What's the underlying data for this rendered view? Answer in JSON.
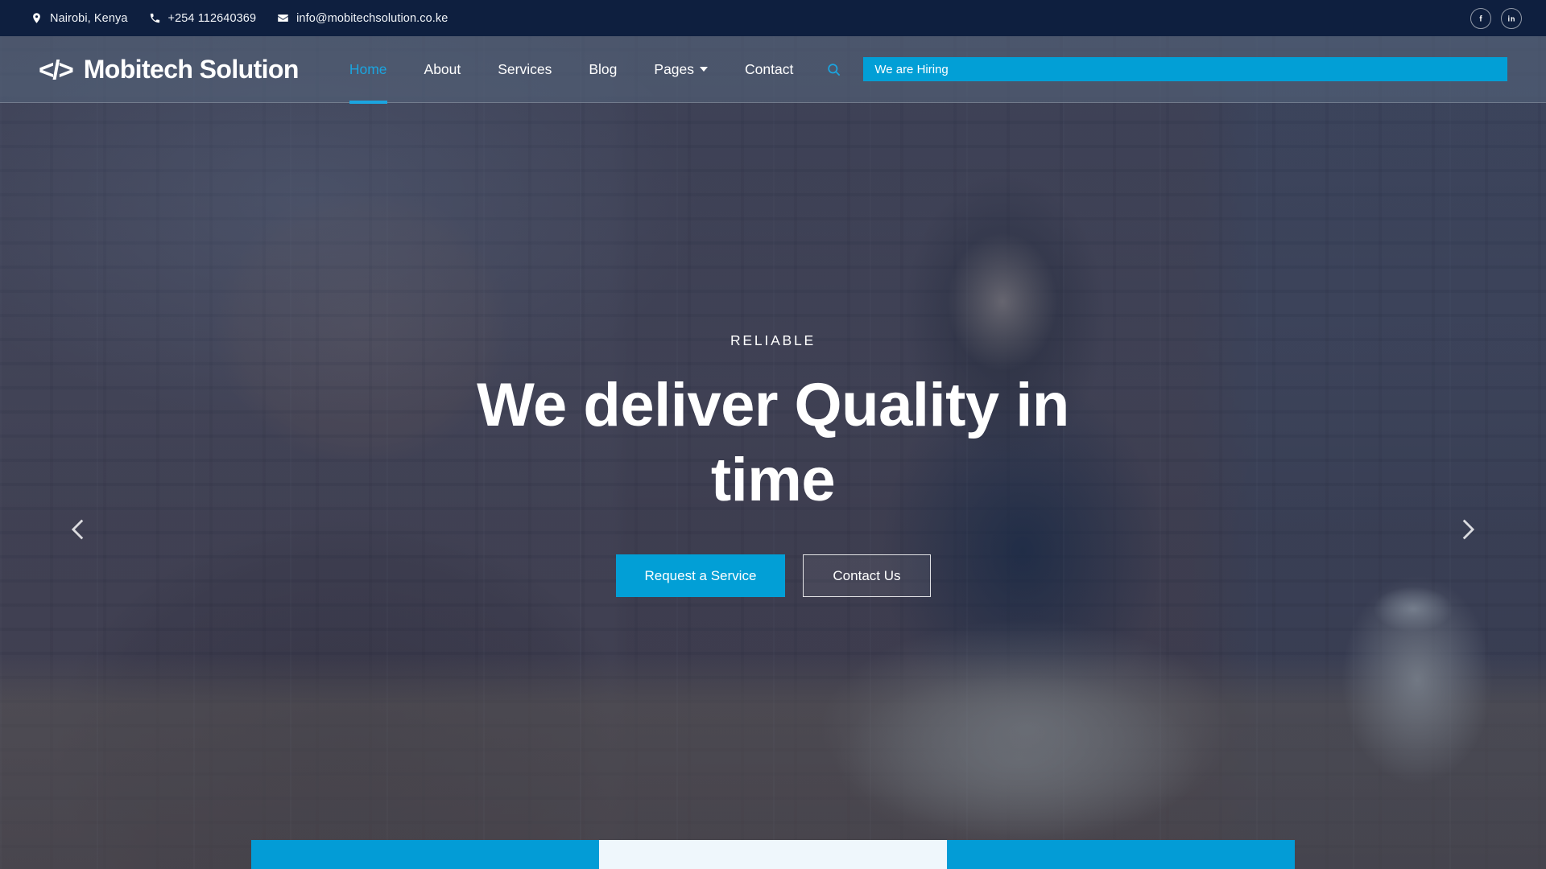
{
  "topbar": {
    "location": {
      "icon": "map-pin-icon",
      "text": "Nairobi, Kenya"
    },
    "phone": {
      "icon": "phone-icon",
      "text": "+254 112640369"
    },
    "email": {
      "icon": "envelope-icon",
      "text": "info@mobitechsolution.co.ke"
    },
    "social": [
      {
        "name": "facebook-icon",
        "label": "f"
      },
      {
        "name": "linkedin-icon",
        "label": "in"
      }
    ]
  },
  "header": {
    "logo": {
      "mark": "</>",
      "text": "Mobitech Solution"
    },
    "nav": [
      {
        "label": "Home",
        "active": true,
        "dropdown": false
      },
      {
        "label": "About",
        "active": false,
        "dropdown": false
      },
      {
        "label": "Services",
        "active": false,
        "dropdown": false
      },
      {
        "label": "Blog",
        "active": false,
        "dropdown": false
      },
      {
        "label": "Pages",
        "active": false,
        "dropdown": true
      },
      {
        "label": "Contact",
        "active": false,
        "dropdown": false
      }
    ],
    "search_icon": "search-icon",
    "hiring_banner": "We are Hiring"
  },
  "hero": {
    "eyebrow": "RELIABLE",
    "headline": "We deliver Quality in time",
    "primary_cta": "Request a Service",
    "secondary_cta": "Contact Us",
    "prev_arrow": "chevron-left-icon",
    "next_arrow": "chevron-right-icon"
  },
  "colors": {
    "navy": "#0e1f3f",
    "accent": "#029fd6",
    "accent_light": "#1ba5e0",
    "card_light": "#eff7fc",
    "header_overlay": "#546279"
  }
}
